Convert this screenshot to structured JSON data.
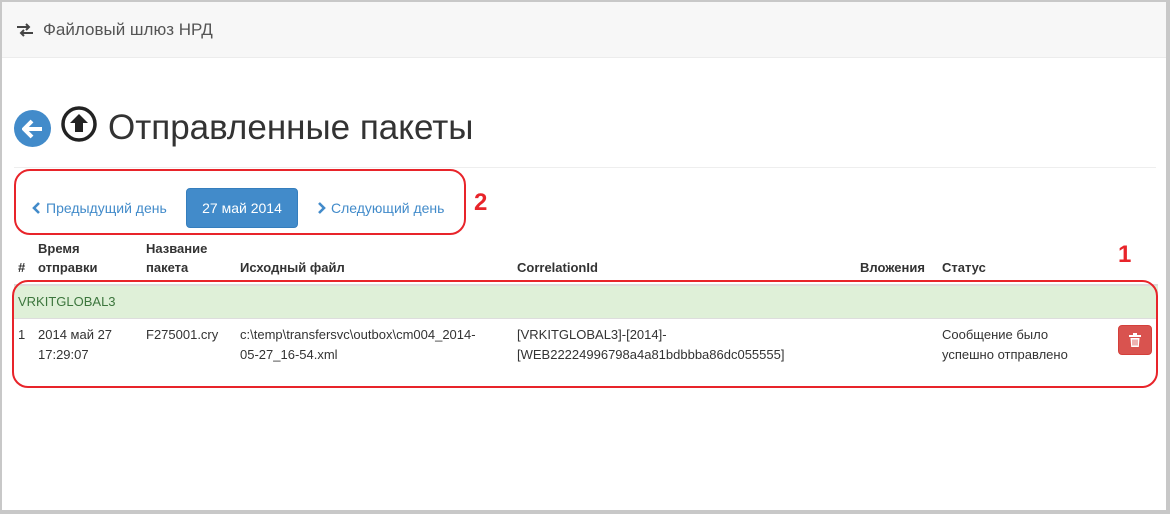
{
  "app": {
    "brand": "Файловый шлюз НРД"
  },
  "header": {
    "title": "Отправленные пакеты"
  },
  "pager": {
    "prev_label": "Предыдущий день",
    "current_label": "27 май 2014",
    "next_label": "Следующий день"
  },
  "annotations": {
    "one": "1",
    "two": "2"
  },
  "table": {
    "columns": {
      "num": "#",
      "time_1": "Время",
      "time_2": "отправки",
      "name_1": "Название",
      "name_2": "пакета",
      "source": "Исходный файл",
      "corr": "CorrelationId",
      "att": "Вложения",
      "status": "Статус"
    },
    "group": "VRKITGLOBAL3",
    "rows": [
      {
        "num": "1",
        "time_1": "2014 май 27",
        "time_2": "17:29:07",
        "name": "F275001.cry",
        "source_1": "c:\\temp\\transfersvc\\outbox\\cm004_2014-",
        "source_2": "05-27_16-54.xml",
        "corr_1": "[VRKITGLOBAL3]-[2014]-",
        "corr_2": "[WEB22224996798a4a81bdbbba86dc055555]",
        "att": "",
        "status_1": "Сообщение было",
        "status_2": "успешно отправлено"
      }
    ]
  },
  "colors": {
    "primary": "#428bca",
    "success_bg": "#dff0d8",
    "success_text": "#3c763d",
    "danger": "#d9534f",
    "annotation": "#e8242a"
  }
}
